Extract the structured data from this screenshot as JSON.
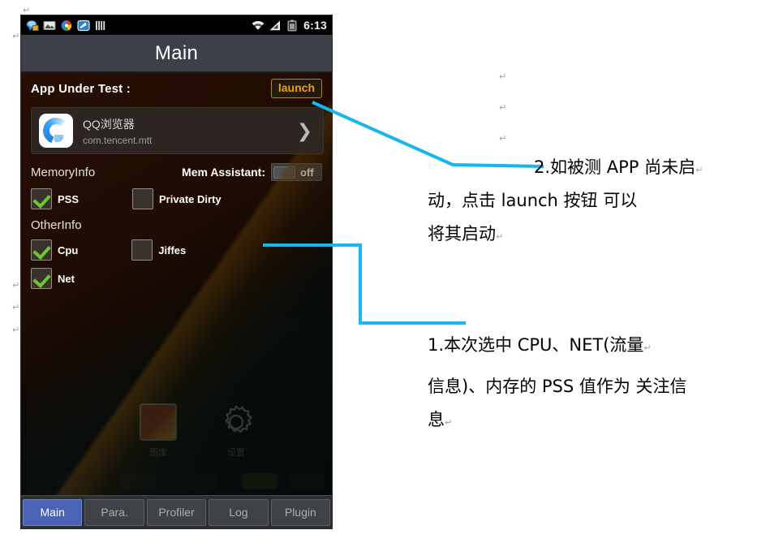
{
  "document": {
    "paragraph_mark": "↵"
  },
  "phone": {
    "statusbar": {
      "time": "6:13",
      "notification_icons": [
        "messaging-icon",
        "picture-icon",
        "browser-icon",
        "reader-icon",
        "bars-icon"
      ],
      "system_icons": [
        "wifi-icon",
        "signal-icon",
        "battery-icon"
      ]
    },
    "titlebar": {
      "title": "Main"
    },
    "app_under_test": {
      "label": "App Under Test :",
      "launch_button": "launch",
      "app_name": "QQ浏览器",
      "app_package": "com.tencent.mtt",
      "chevron": "❯"
    },
    "memory_info": {
      "section_title": "MemoryInfo",
      "mem_assistant_label": "Mem Assistant:",
      "mem_assistant_state": "off",
      "checkboxes": [
        {
          "label": "PSS",
          "checked": true
        },
        {
          "label": "Private Dirty",
          "checked": false
        }
      ]
    },
    "other_info": {
      "section_title": "OtherInfo",
      "checkboxes": [
        {
          "label": "Cpu",
          "checked": true
        },
        {
          "label": "Jiffes",
          "checked": false
        },
        {
          "label": "Net",
          "checked": true
        }
      ]
    },
    "wallpaper_icons": [
      {
        "label": "图库"
      },
      {
        "label": "设置"
      }
    ],
    "tabs": [
      {
        "label": "Main",
        "active": true
      },
      {
        "label": "Para.",
        "active": false
      },
      {
        "label": "Profiler",
        "active": false
      },
      {
        "label": "Log",
        "active": false
      },
      {
        "label": "Plugin",
        "active": false
      }
    ]
  },
  "annotations": {
    "leader_color": "#16b6ef",
    "note2": {
      "line1": "2.如被测 APP 尚未启",
      "line2": "动，点击 launch 按钮 可以",
      "line3": "将其启动"
    },
    "note1": {
      "line1": "1.本次选中 CPU、NET(流量",
      "line2": "信息)、内存的 PSS 值作为 关注信",
      "line3": "息"
    }
  }
}
